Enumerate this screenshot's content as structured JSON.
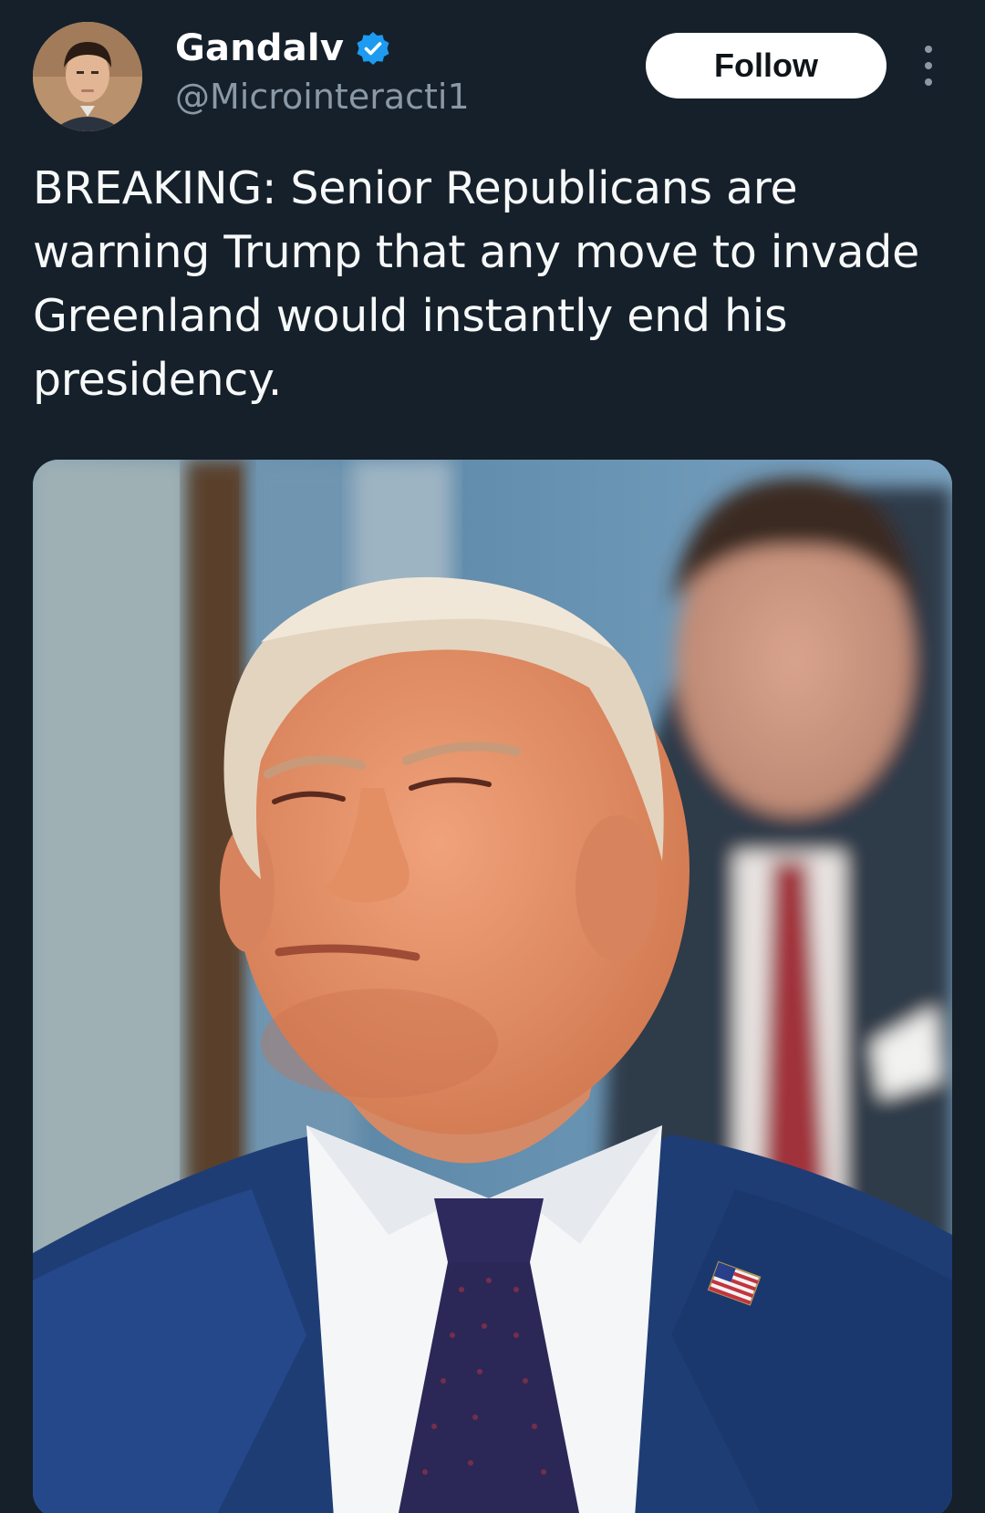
{
  "author": {
    "display_name": "Gandalv",
    "handle": "@Microinteracti1",
    "verified": true,
    "avatar_icon": "person-avatar"
  },
  "follow_button": {
    "label": "Follow"
  },
  "more_menu": {
    "icon": "more-vertical-icon"
  },
  "tweet": {
    "text": "BREAKING: Senior Republicans are warning Trump that any move to invade Greenland would instantly end his presidency."
  },
  "media": {
    "type": "photo"
  },
  "colors": {
    "background": "#15202b",
    "verified_badge": "#1d9bf0",
    "secondary_text": "#8b98a5",
    "follow_button_bg": "#ffffff"
  }
}
